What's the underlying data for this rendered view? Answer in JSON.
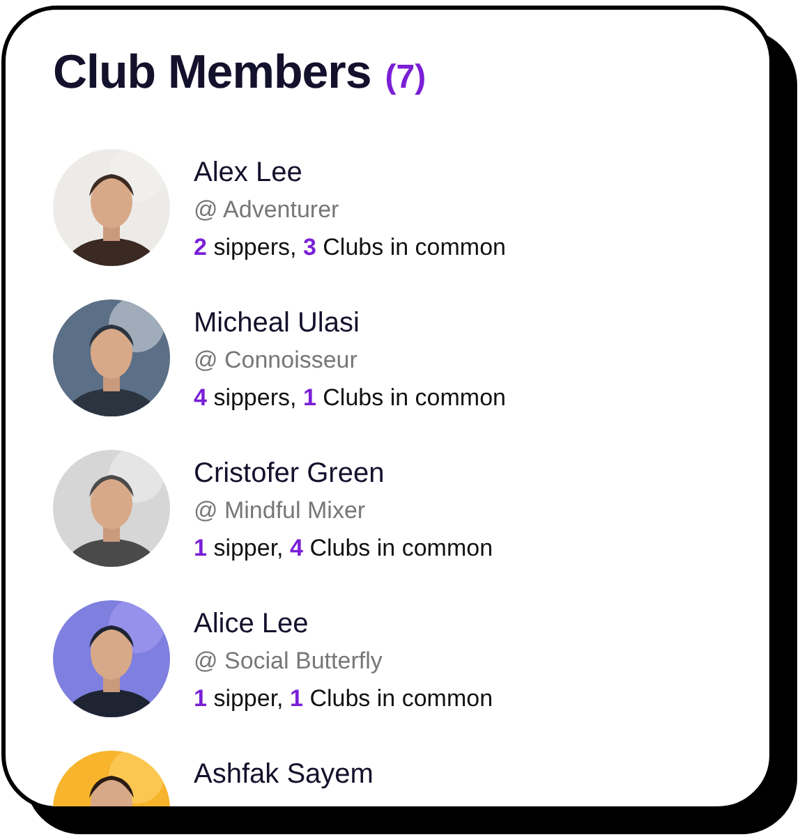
{
  "title": "Club Members",
  "count": "(7)",
  "members": [
    {
      "name": "Alex Lee",
      "handle": "@ Adventurer",
      "stats": "**2** sippers, **3** Clubs in common"
    },
    {
      "name": "Micheal Ulasi",
      "handle": "@ Connoisseur",
      "stats": "**4** sippers, **1** Clubs in common"
    },
    {
      "name": "Cristofer Green",
      "handle": "@ Mindful Mixer",
      "stats": "**1** sipper, **4** Clubs in common"
    },
    {
      "name": "Alice Lee",
      "handle": "@ Social Butterfly",
      "stats": "**1** sipper, **1** Clubs in common"
    },
    {
      "name": "Ashfak Sayem"
    }
  ]
}
